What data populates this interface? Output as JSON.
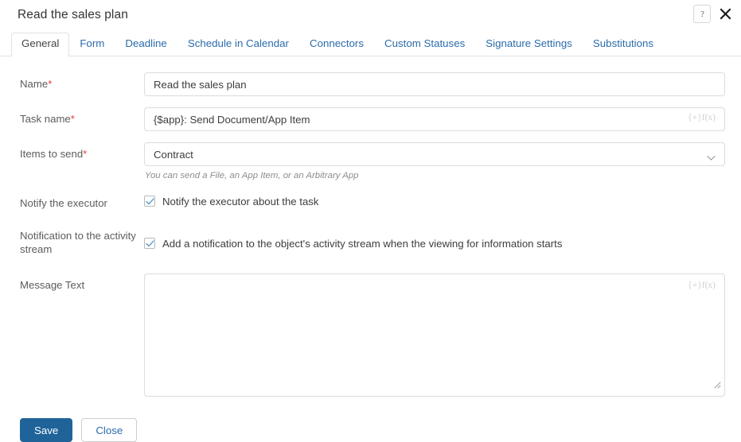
{
  "header": {
    "title": "Read the sales plan",
    "help_icon": "question-mark-icon",
    "close_icon": "close-icon"
  },
  "tabs": [
    {
      "label": "General",
      "active": true
    },
    {
      "label": "Form",
      "active": false
    },
    {
      "label": "Deadline",
      "active": false
    },
    {
      "label": "Schedule in Calendar",
      "active": false
    },
    {
      "label": "Connectors",
      "active": false
    },
    {
      "label": "Custom Statuses",
      "active": false
    },
    {
      "label": "Signature Settings",
      "active": false
    },
    {
      "label": "Substitutions",
      "active": false
    }
  ],
  "form": {
    "name": {
      "label": "Name",
      "required_marker": "*",
      "value": "Read the sales plan",
      "placeholder": ""
    },
    "task_name": {
      "label": "Task name",
      "required_marker": "*",
      "value": "{$app}: Send Document/App Item",
      "placeholder": "",
      "fx_hint": "{+}f(x)"
    },
    "items_to_send": {
      "label": "Items to send",
      "required_marker": "*",
      "selected": "Contract",
      "chevron_icon": "chevron-down-icon",
      "hint": "You can send a File, an App Item, or an Arbitrary App"
    },
    "notify_executor": {
      "label": "Notify the executor",
      "checkbox_label": "Notify the executor about the task",
      "checked": true
    },
    "activity_stream": {
      "label": "Notification to the activity stream",
      "checkbox_label": "Add a notification to the object's activity stream when the viewing for information starts",
      "checked": true
    },
    "message_text": {
      "label": "Message Text",
      "value": "",
      "placeholder": "",
      "fx_hint": "{+}f(x)"
    }
  },
  "footer": {
    "save_label": "Save",
    "close_label": "Close"
  },
  "colors": {
    "primary": "#1f6399",
    "link": "#2b6cab",
    "required": "#e8403a",
    "border": "#dcdcdc",
    "check": "#4a90c4"
  }
}
